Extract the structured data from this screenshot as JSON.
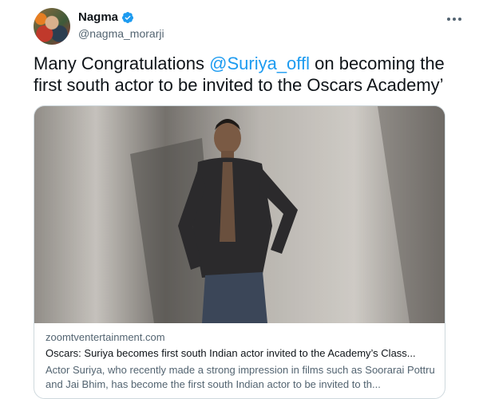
{
  "author": {
    "name": "Nagma",
    "handle": "@nagma_morarji"
  },
  "tweet": {
    "text_before": "Many Congratulations ",
    "mention": "@Suriya_offl",
    "text_after": " on becoming the first south actor to be invited to the Oscars Academy’"
  },
  "card": {
    "domain": "zoomtventertainment.com",
    "title": "Oscars: Suriya becomes first south Indian actor invited to the Academy’s Class...",
    "description": "Actor Suriya, who recently made a strong impression in films such as Soorarai Pottru and Jai Bhim, has become the first south Indian actor to be invited to th..."
  },
  "colors": {
    "link": "#1d9bf0",
    "secondary_text": "#536471",
    "border": "#cfd9de",
    "verified_badge": "#1d9bf0"
  },
  "icons": [
    "verified-badge-icon",
    "more-options-icon"
  ]
}
